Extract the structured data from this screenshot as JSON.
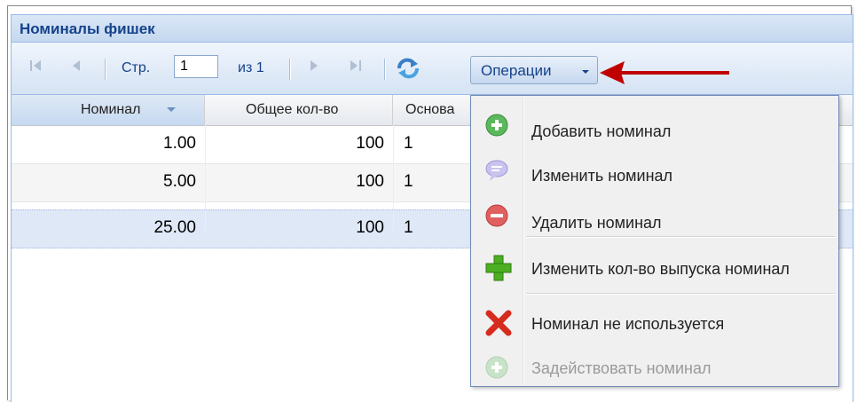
{
  "panel": {
    "title": "Номиналы фишек"
  },
  "toolbar": {
    "page_label": "Стр.",
    "page_value": "1",
    "of_label": "из 1",
    "operations_label": "Операции"
  },
  "grid": {
    "columns": [
      "Номинал",
      "Общее кол-во",
      "Основа"
    ],
    "rows": [
      {
        "nominal": "1.00",
        "total": "100",
        "base": "1"
      },
      {
        "nominal": "5.00",
        "total": "100",
        "base": "1"
      },
      {
        "nominal": "25.00",
        "total": "100",
        "base": "1"
      }
    ]
  },
  "menu": {
    "items": [
      {
        "label": "Добавить номинал",
        "icon": "add-circle-icon",
        "enabled": true
      },
      {
        "label": "Изменить номинал",
        "icon": "edit-bubble-icon",
        "enabled": true
      },
      {
        "label": "Удалить номинал",
        "icon": "remove-circle-icon",
        "enabled": true
      },
      {
        "label": "Изменить кол-во выпуска номинал",
        "icon": "green-plus-icon",
        "enabled": true
      },
      {
        "label": "Номинал не используется",
        "icon": "red-x-icon",
        "enabled": true
      },
      {
        "label": "Задействовать номинал",
        "icon": "add-circle-icon",
        "enabled": false
      }
    ]
  },
  "colors": {
    "accent": "#15428b",
    "arrow": "#c00000",
    "selected_row": "#dfe8f6"
  }
}
